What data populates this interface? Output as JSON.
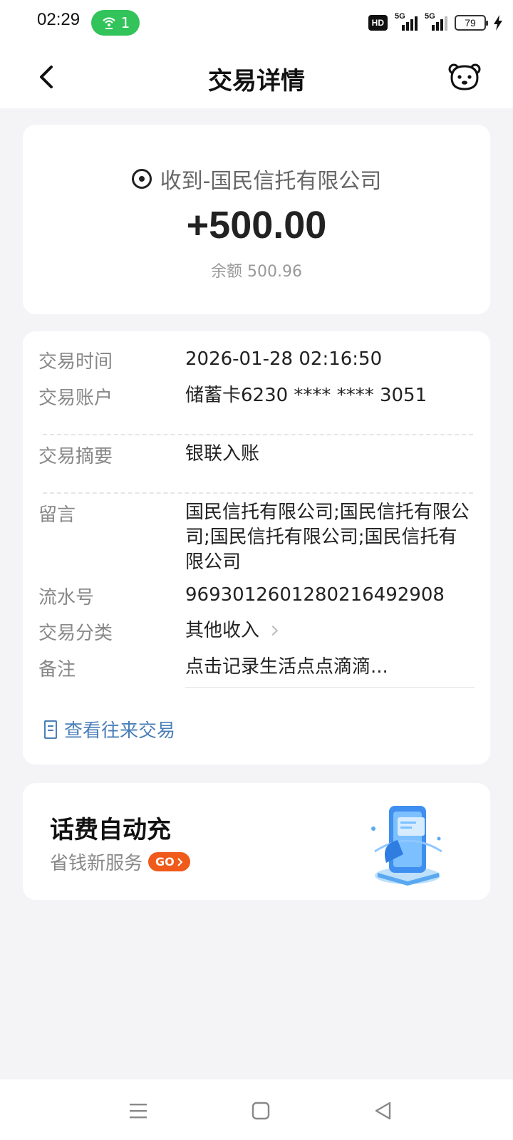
{
  "status_bar": {
    "time": "02:29",
    "hotspot_count": "1",
    "network_left": "5G",
    "network_right": "5G",
    "battery": "79",
    "hd_label": "HD"
  },
  "header": {
    "title": "交易详情",
    "back_icon": "chevron-left-icon",
    "service_icon": "customer-service-icon"
  },
  "summary": {
    "payer_text": "收到-国民信托有限公司",
    "amount": "+500.00",
    "balance": "余额 500.96"
  },
  "details": {
    "time_label": "交易时间",
    "time_value": "2026-01-28 02:16:50",
    "account_label": "交易账户",
    "account_value": "储蓄卡6230 **** **** 3051",
    "summary_label": "交易摘要",
    "summary_value": "银联入账",
    "message_label": "留言",
    "message_value": "国民信托有限公司;国民信托有限公司;国民信托有限公司;国民信托有限公司",
    "serial_label": "流水号",
    "serial_value": "9693012601280216492908",
    "category_label": "交易分类",
    "category_value": "其他收入",
    "memo_label": "备注",
    "memo_placeholder": "点击记录生活点点滴滴...",
    "history_link": "查看往来交易"
  },
  "promo": {
    "title": "话费自动充",
    "subtitle": "省钱新服务",
    "go_label": "GO"
  },
  "colors": {
    "accent_link": "#4a7fb8",
    "go_badge": "#f05a1a",
    "hotspot": "#32c35a"
  }
}
